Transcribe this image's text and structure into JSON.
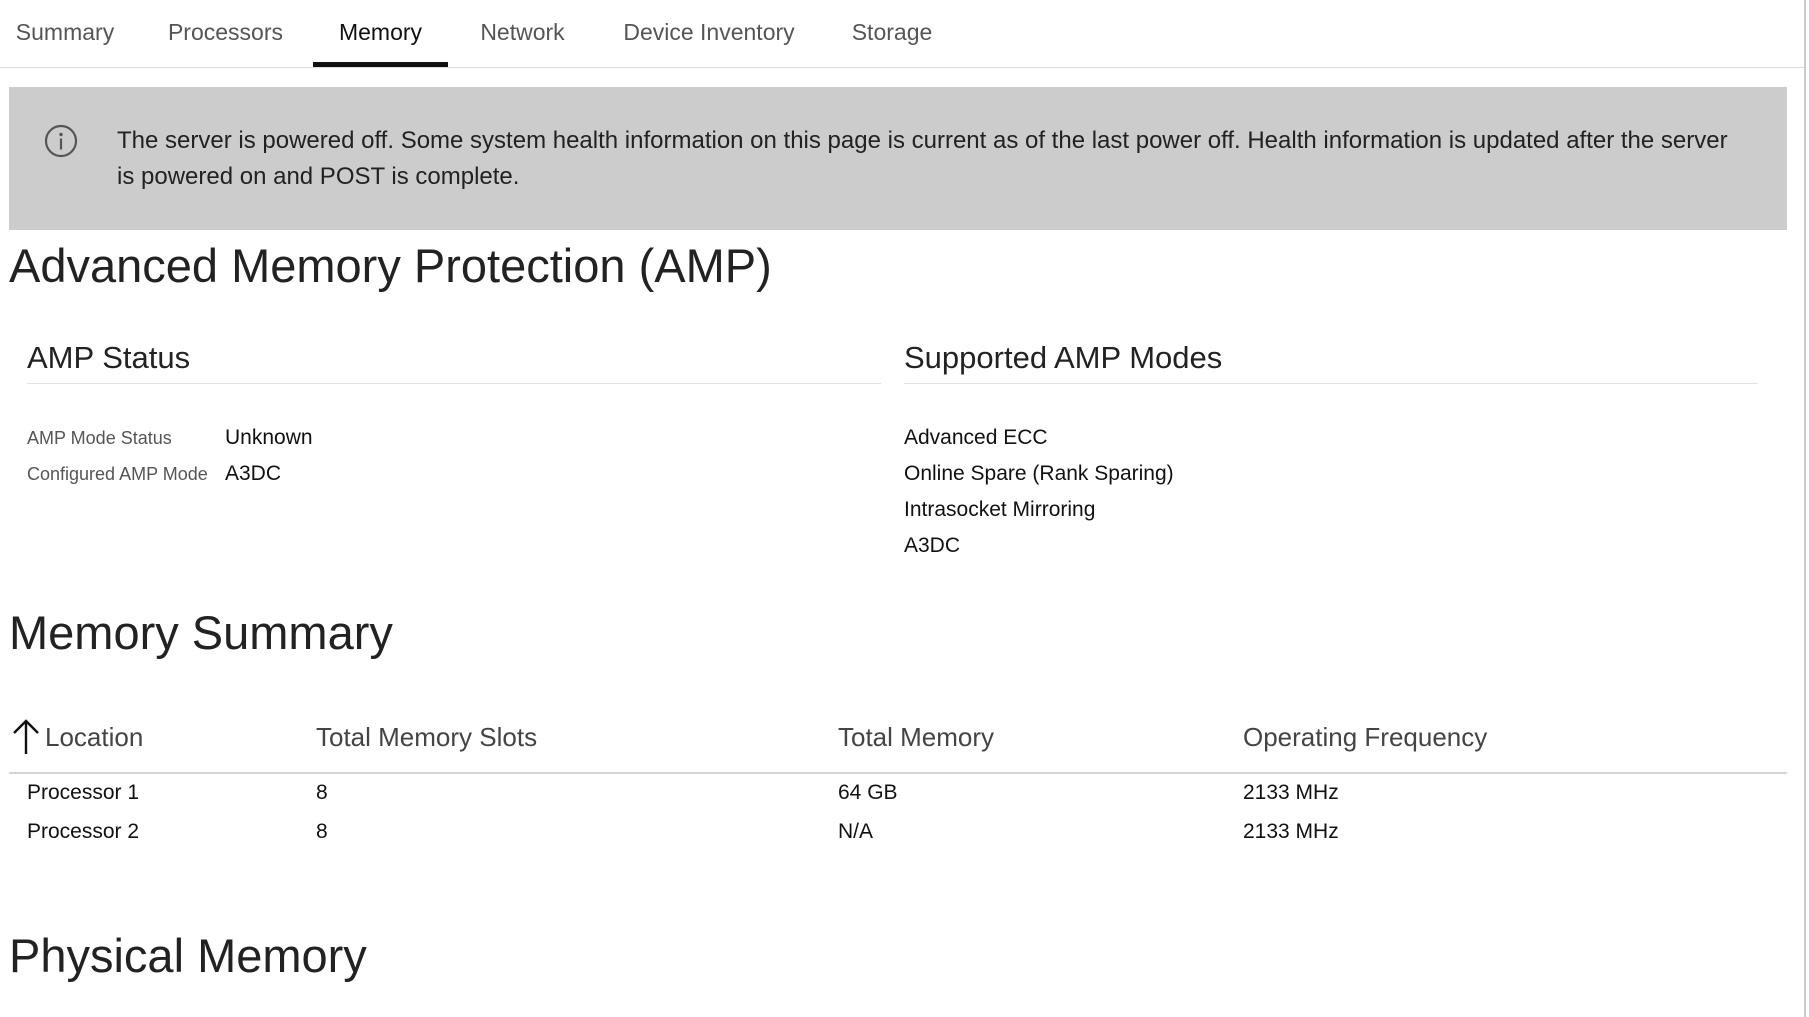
{
  "tabs": [
    {
      "label": "Summary",
      "active": false
    },
    {
      "label": "Processors",
      "active": false
    },
    {
      "label": "Memory",
      "active": true
    },
    {
      "label": "Network",
      "active": false
    },
    {
      "label": "Device Inventory",
      "active": false
    },
    {
      "label": "Storage",
      "active": false
    }
  ],
  "alert": {
    "icon": "info-icon",
    "message": "The server is powered off. Some system health information on this page is current as of the last power off. Health information is updated after the server is powered on and POST is complete."
  },
  "amp": {
    "title": "Advanced Memory Protection (AMP)",
    "status": {
      "title": "AMP Status",
      "mode_status_label": "AMP Mode Status",
      "mode_status_value": "Unknown",
      "configured_label": "Configured AMP Mode",
      "configured_value": "A3DC"
    },
    "modes": {
      "title": "Supported AMP Modes",
      "items": [
        "Advanced ECC",
        "Online Spare (Rank Sparing)",
        "Intrasocket Mirroring",
        "A3DC"
      ]
    }
  },
  "memory_summary": {
    "title": "Memory Summary",
    "sort_icon": "arrow-up-icon",
    "columns": [
      "Location",
      "Total Memory Slots",
      "Total Memory",
      "Operating Frequency"
    ],
    "rows": [
      [
        "Processor 1",
        "8",
        "64 GB",
        "2133 MHz"
      ],
      [
        "Processor 2",
        "8",
        "N/A",
        "2133 MHz"
      ]
    ]
  },
  "physical_memory": {
    "title": "Physical Memory"
  }
}
